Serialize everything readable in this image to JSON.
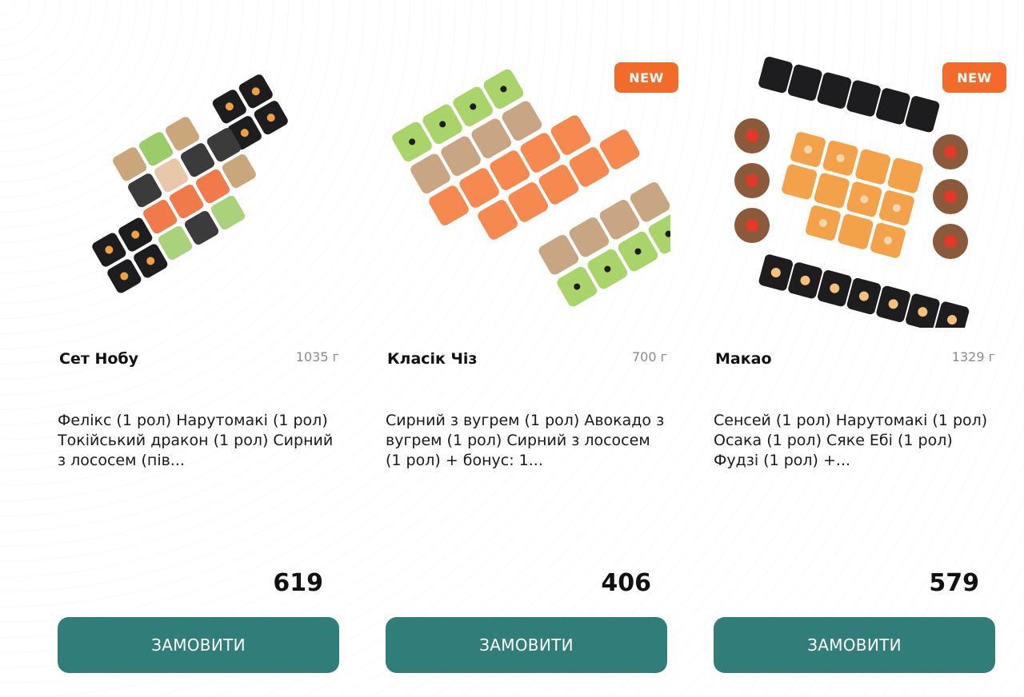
{
  "products": [
    {
      "title": "Сет Нобу",
      "weight": "1035 г",
      "description": "Фелікс (1 рол) Нарутомакі (1 рол) Токійський дракон (1 рол) Сирний з лососем (пів...",
      "price": "619",
      "button_label": "ЗАМОВИТИ",
      "badge": "",
      "image_icon": "sushi-set-image"
    },
    {
      "title": "Класік Чіз",
      "weight": "700 г",
      "description": "Сирний з вугрем (1 рол) Авокадо з вугрем (1 рол) Сирний з лососем (1 рол) + бонус: 1...",
      "price": "406",
      "button_label": "ЗАМОВИТИ",
      "badge": "NEW",
      "image_icon": "sushi-set-image"
    },
    {
      "title": "Макао",
      "weight": "1329 г",
      "description": "Сенсей (1 рол) Нарутомакі (1 рол) Осака (1 рол) Сяке Ебі (1 рол) Фудзі (1 рол) +...",
      "price": "579",
      "button_label": "ЗАМОВИТИ",
      "badge": "NEW",
      "image_icon": "sushi-set-image"
    }
  ],
  "colors": {
    "button": "#317d7a",
    "badge": "#f26b2a",
    "weight_text": "#8a8a8a"
  }
}
